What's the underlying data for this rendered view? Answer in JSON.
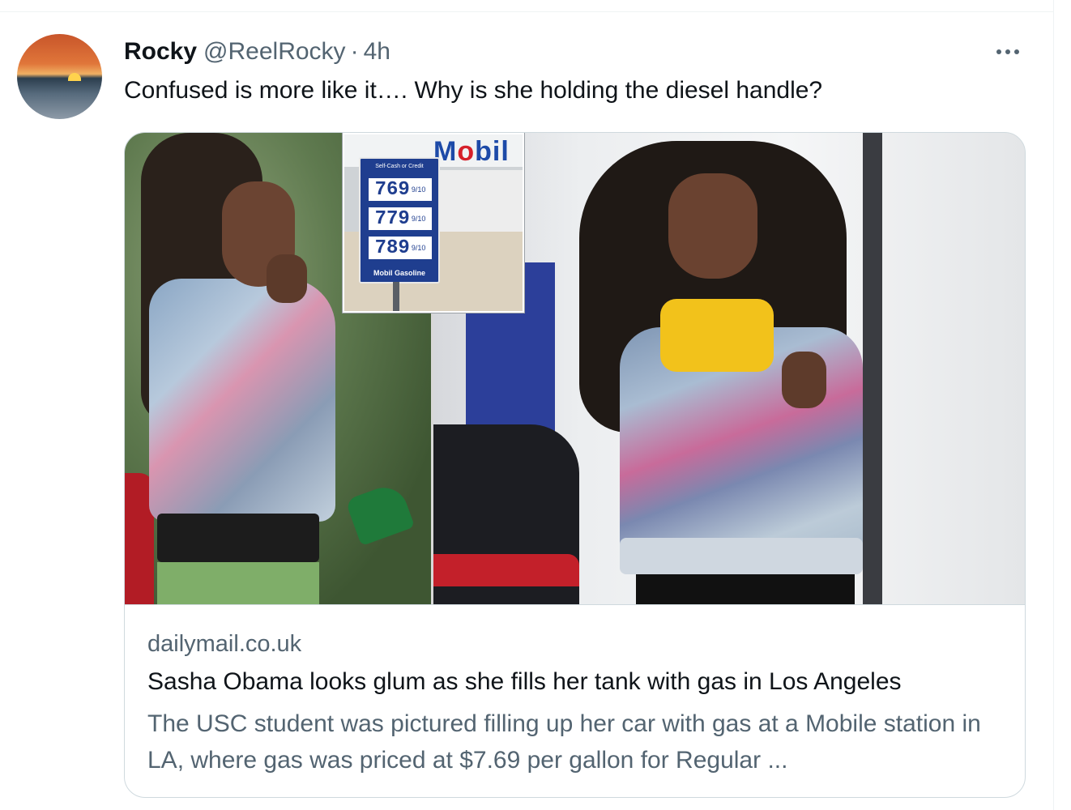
{
  "tweet": {
    "author_name": "Rocky",
    "author_handle": "@ReelRocky",
    "separator": "·",
    "time": "4h",
    "text": "Confused is more like it…. Why is she holding the diesel handle?"
  },
  "card": {
    "domain": "dailymail.co.uk",
    "title": "Sasha Obama looks glum as she fills her tank with gas in Los Angeles",
    "description": "The USC student was pictured filling up her car with gas at a Mobile station in LA, where gas was priced at $7.69 per gallon for Regular ...",
    "image": {
      "sign_brand": "Mobil",
      "sign_header": "Self-Cash or Credit",
      "prices": [
        "769",
        "779",
        "789"
      ],
      "price_fraction": "9/10",
      "sign_footer": "Mobil Gasoline"
    }
  },
  "icons": {
    "more": "more-options-icon",
    "avatar": "sunset-avatar"
  },
  "colors": {
    "text_primary": "#0f1419",
    "text_secondary": "#536471",
    "border": "#cfd9de",
    "mobil_blue": "#1d4aa8",
    "mobil_red": "#d6202a"
  }
}
